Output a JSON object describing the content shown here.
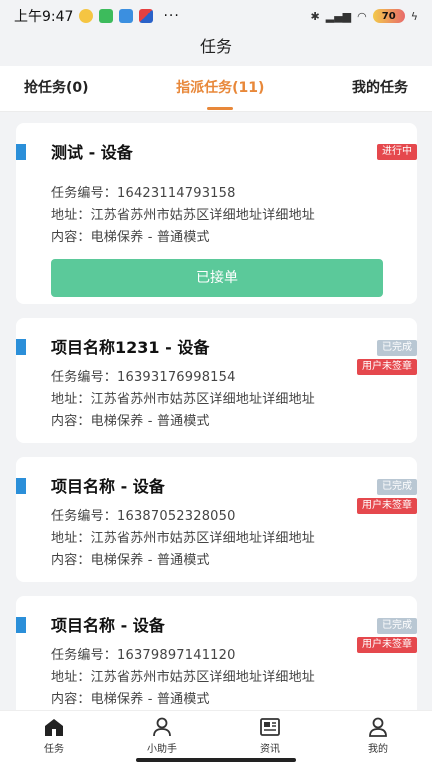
{
  "status_bar": {
    "time": "上午9:47",
    "battery": "70",
    "more": "···"
  },
  "header": {
    "title": "任务"
  },
  "tabs": [
    {
      "label": "抢任务(0)",
      "active": false
    },
    {
      "label": "指派任务(11)",
      "active": true
    },
    {
      "label": "我的任务",
      "active": false
    }
  ],
  "tasks": [
    {
      "title": "测试 - 设备",
      "number": "任务编号：16423114793158",
      "address": "地址：江苏省苏州市姑苏区详细地址详细地址",
      "content": "内容：电梯保养 - 普通模式",
      "badges": [
        {
          "text": "进行中",
          "color": "red"
        }
      ],
      "button": "已接单"
    },
    {
      "title": "项目名称1231 - 设备",
      "number": "任务编号：16393176998154",
      "address": "地址：江苏省苏州市姑苏区详细地址详细地址",
      "content": "内容：电梯保养 - 普通模式",
      "badges": [
        {
          "text": "已完成",
          "color": "gray"
        },
        {
          "text": "用户未签章",
          "color": "red"
        }
      ]
    },
    {
      "title": "项目名称 - 设备",
      "number": "任务编号：16387052328050",
      "address": "地址：江苏省苏州市姑苏区详细地址详细地址",
      "content": "内容：电梯保养 - 普通模式",
      "badges": [
        {
          "text": "已完成",
          "color": "gray"
        },
        {
          "text": "用户未签章",
          "color": "red"
        }
      ]
    },
    {
      "title": "项目名称 - 设备",
      "number": "任务编号：16379897141120",
      "address": "地址：江苏省苏州市姑苏区详细地址详细地址",
      "content": "内容：电梯保养 - 普通模式",
      "badges": [
        {
          "text": "已完成",
          "color": "gray"
        },
        {
          "text": "用户未签章",
          "color": "red"
        }
      ]
    }
  ],
  "tabbar": [
    {
      "label": "任务",
      "icon": "home-icon",
      "active": true
    },
    {
      "label": "小助手",
      "icon": "person-icon",
      "active": false
    },
    {
      "label": "资讯",
      "icon": "news-icon",
      "active": false
    },
    {
      "label": "我的",
      "icon": "profile-icon",
      "active": false
    }
  ],
  "colors": {
    "accent": "#e8883a",
    "button_green": "#5bc99a",
    "badge_red": "#e5484d",
    "badge_gray": "#b9c7d3",
    "card_marker": "#2b8fd9"
  }
}
